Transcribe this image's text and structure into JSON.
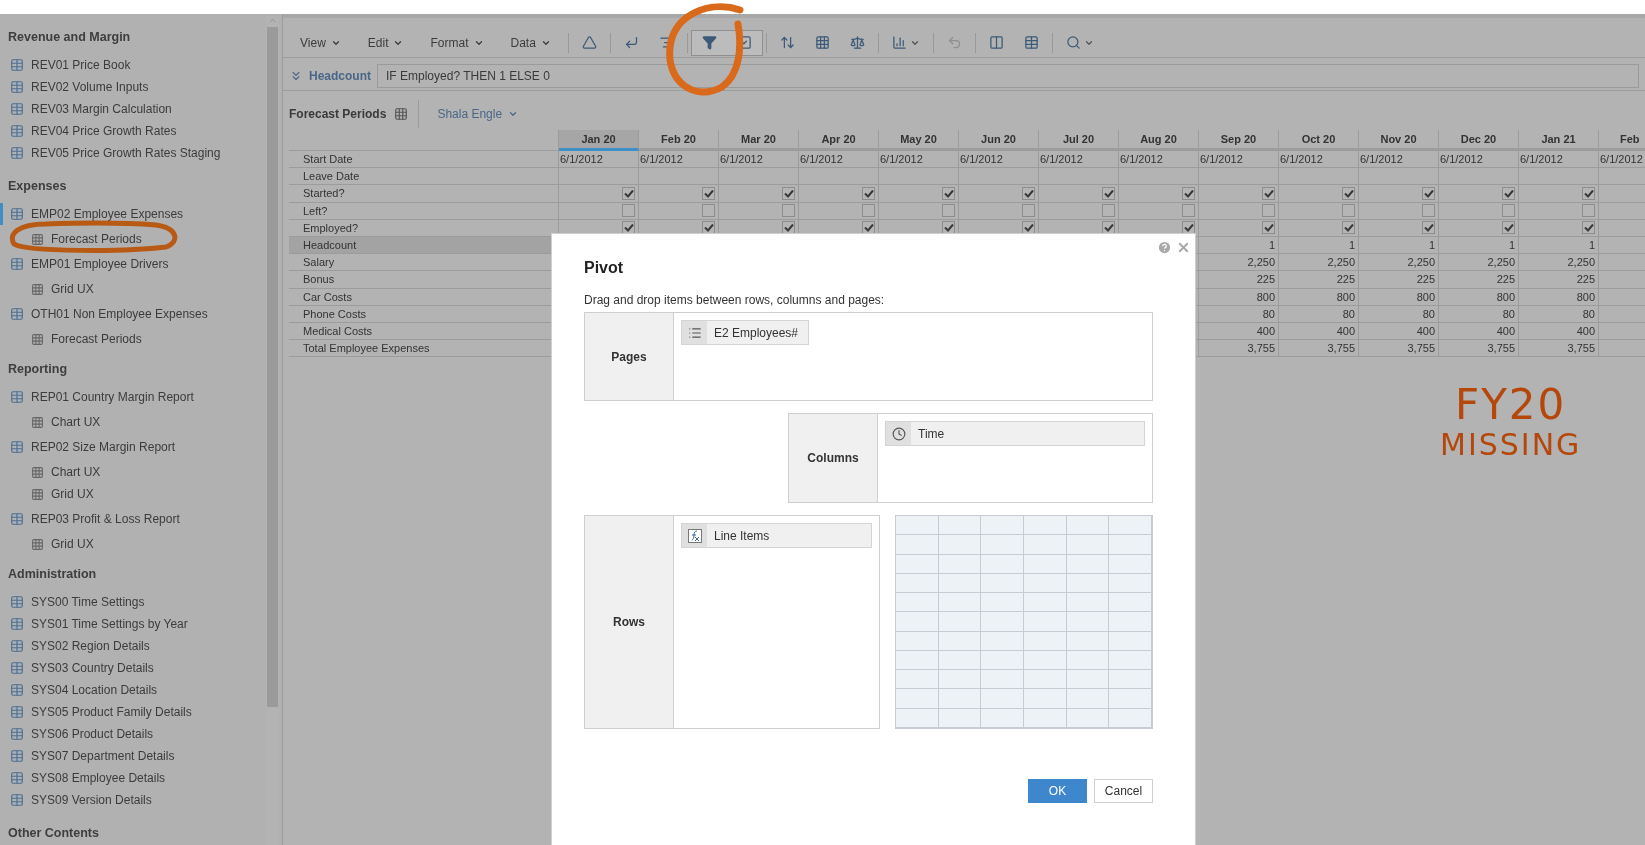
{
  "sidebar": {
    "sections": [
      {
        "title": "Revenue and Margin",
        "items": [
          {
            "label": "REV01 Price Book",
            "selected": false
          },
          {
            "label": "REV02 Volume Inputs",
            "selected": false
          },
          {
            "label": "REV03 Margin Calculation",
            "selected": false
          },
          {
            "label": "REV04 Price Growth Rates",
            "selected": false
          },
          {
            "label": "REV05 Price Growth Rates Staging",
            "selected": false
          }
        ]
      },
      {
        "title": "Expenses",
        "items": [
          {
            "label": "EMP02 Employee Expenses",
            "selected": true,
            "children": [
              {
                "label": "Forecast Periods",
                "selected": false
              }
            ]
          },
          {
            "label": "EMP01 Employee Drivers",
            "selected": false,
            "children": [
              {
                "label": "Grid UX",
                "selected": false
              }
            ]
          },
          {
            "label": "OTH01 Non Employee Expenses",
            "selected": false,
            "children": [
              {
                "label": "Forecast Periods",
                "selected": false
              }
            ]
          }
        ]
      },
      {
        "title": "Reporting",
        "items": [
          {
            "label": "REP01 Country Margin Report",
            "selected": false,
            "children": [
              {
                "label": "Chart UX",
                "selected": false
              }
            ]
          },
          {
            "label": "REP02 Size Margin Report",
            "selected": false,
            "children": [
              {
                "label": "Chart UX",
                "selected": false
              },
              {
                "label": "Grid UX",
                "selected": false
              }
            ]
          },
          {
            "label": "REP03 Profit & Loss Report",
            "selected": false,
            "children": [
              {
                "label": "Grid UX",
                "selected": false
              }
            ]
          }
        ]
      },
      {
        "title": "Administration",
        "items": [
          {
            "label": "SYS00 Time Settings",
            "selected": false
          },
          {
            "label": "SYS01 Time Settings by Year",
            "selected": false
          },
          {
            "label": "SYS02 Region Details",
            "selected": false
          },
          {
            "label": "SYS03 Country Details",
            "selected": false
          },
          {
            "label": "SYS04 Location Details",
            "selected": false
          },
          {
            "label": "SYS05 Product Family Details",
            "selected": false
          },
          {
            "label": "SYS06 Product Details",
            "selected": false
          },
          {
            "label": "SYS07 Department Details",
            "selected": false
          },
          {
            "label": "SYS08 Employee Details",
            "selected": false
          },
          {
            "label": "SYS09 Version Details",
            "selected": false
          }
        ]
      },
      {
        "title": "Other Contents"
      }
    ]
  },
  "toolbar": {
    "menus": [
      "View",
      "Edit",
      "Format",
      "Data"
    ],
    "groups": [
      {
        "active": false,
        "tools": [
          {
            "kind": "ruler",
            "dropdown": false,
            "disabled": false
          }
        ]
      },
      {
        "active": false,
        "tools": [
          {
            "kind": "corner",
            "dropdown": false,
            "disabled": false
          },
          {
            "kind": "align",
            "dropdown": false,
            "disabled": false
          }
        ]
      },
      {
        "active": true,
        "tools": [
          {
            "kind": "filter",
            "dropdown": false,
            "disabled": false
          },
          {
            "kind": "check",
            "dropdown": false,
            "disabled": false
          }
        ]
      },
      {
        "active": false,
        "tools": [
          {
            "kind": "sort",
            "dropdown": false,
            "disabled": false
          },
          {
            "kind": "grid",
            "dropdown": false,
            "disabled": false
          },
          {
            "kind": "scale",
            "dropdown": false,
            "disabled": false
          }
        ]
      },
      {
        "active": false,
        "tools": [
          {
            "kind": "chart",
            "dropdown": true,
            "disabled": false
          }
        ]
      },
      {
        "active": false,
        "tools": [
          {
            "kind": "undo",
            "dropdown": false,
            "disabled": true
          }
        ]
      },
      {
        "active": false,
        "tools": [
          {
            "kind": "columns",
            "dropdown": false,
            "disabled": false
          },
          {
            "kind": "table",
            "dropdown": false,
            "disabled": false
          }
        ]
      },
      {
        "active": false,
        "tools": [
          {
            "kind": "search",
            "dropdown": true,
            "disabled": false
          }
        ]
      }
    ]
  },
  "formula_bar": {
    "item": "Headcount",
    "formula": "IF Employed? THEN 1 ELSE 0"
  },
  "view_bar": {
    "title": "Forecast Periods",
    "page_selector": "Shala Engle"
  },
  "grid": {
    "columns": [
      {
        "label": "Jan 20",
        "selected": true
      },
      {
        "label": "Feb 20",
        "selected": false
      },
      {
        "label": "Mar 20",
        "selected": false
      },
      {
        "label": "Apr 20",
        "selected": false
      },
      {
        "label": "May 20",
        "selected": false
      },
      {
        "label": "Jun 20",
        "selected": false
      },
      {
        "label": "Jul 20",
        "selected": false
      },
      {
        "label": "Aug 20",
        "selected": false
      },
      {
        "label": "Sep 20",
        "selected": false
      },
      {
        "label": "Oct 20",
        "selected": false
      },
      {
        "label": "Nov 20",
        "selected": false
      },
      {
        "label": "Dec 20",
        "selected": false
      },
      {
        "label": "Jan 21",
        "selected": false
      },
      {
        "label": "Feb",
        "selected": false
      }
    ],
    "rows": [
      {
        "label": "Start Date",
        "kind": "text",
        "selected": false,
        "cells": [
          "6/1/2012",
          "6/1/2012",
          "6/1/2012",
          "6/1/2012",
          "6/1/2012",
          "6/1/2012",
          "6/1/2012",
          "6/1/2012",
          "6/1/2012",
          "6/1/2012",
          "6/1/2012",
          "6/1/2012",
          "6/1/2012",
          "6/1/2012"
        ]
      },
      {
        "label": "Leave Date",
        "kind": "text",
        "selected": false
      },
      {
        "label": "Started?",
        "kind": "check",
        "selected": false,
        "cells": [
          true,
          true,
          true,
          true,
          true,
          true,
          true,
          true,
          true,
          true,
          true,
          true,
          true
        ]
      },
      {
        "label": "Left?",
        "kind": "check",
        "selected": false,
        "cells": [
          false,
          false,
          false,
          false,
          false,
          false,
          false,
          false,
          false,
          false,
          false,
          false,
          false
        ]
      },
      {
        "label": "Employed?",
        "kind": "check",
        "selected": false,
        "cells": [
          true,
          true,
          true,
          true,
          true,
          true,
          true,
          true,
          true,
          true,
          true,
          true,
          true
        ]
      },
      {
        "label": "Headcount",
        "kind": "number",
        "selected": true,
        "cells": [
          null,
          null,
          null,
          null,
          null,
          null,
          null,
          null,
          "1",
          "1",
          "1",
          "1",
          "1"
        ]
      },
      {
        "label": "Salary",
        "kind": "number",
        "selected": false,
        "cells": [
          null,
          null,
          null,
          null,
          null,
          null,
          null,
          null,
          "2,250",
          "2,250",
          "2,250",
          "2,250",
          "2,250"
        ]
      },
      {
        "label": "Bonus",
        "kind": "number",
        "selected": false,
        "cells": [
          null,
          null,
          null,
          null,
          null,
          null,
          null,
          null,
          "225",
          "225",
          "225",
          "225",
          "225"
        ]
      },
      {
        "label": "Car Costs",
        "kind": "number",
        "selected": false,
        "cells": [
          null,
          null,
          null,
          null,
          null,
          null,
          null,
          null,
          "800",
          "800",
          "800",
          "800",
          "800"
        ]
      },
      {
        "label": "Phone Costs",
        "kind": "number",
        "selected": false,
        "cells": [
          null,
          null,
          null,
          null,
          null,
          null,
          null,
          null,
          "80",
          "80",
          "80",
          "80",
          "80"
        ]
      },
      {
        "label": "Medical Costs",
        "kind": "number",
        "selected": false,
        "cells": [
          null,
          null,
          null,
          null,
          null,
          null,
          null,
          null,
          "400",
          "400",
          "400",
          "400",
          "400"
        ]
      },
      {
        "label": "Total Employee Expenses",
        "kind": "number",
        "selected": false,
        "cells": [
          null,
          null,
          null,
          null,
          null,
          null,
          null,
          null,
          "3,755",
          "3,755",
          "3,755",
          "3,755",
          "3,755"
        ]
      }
    ]
  },
  "handwritten_note": [
    "FY20",
    "MISSING"
  ],
  "dialog": {
    "title": "Pivot",
    "instructions": "Drag and drop items between rows, columns and pages:",
    "pages": {
      "label": "Pages",
      "items": [
        {
          "label": "E2 Employees#",
          "kind": "list"
        }
      ]
    },
    "columns": {
      "label": "Columns",
      "items": [
        {
          "label": "Time",
          "kind": "time"
        }
      ]
    },
    "rows": {
      "label": "Rows",
      "items": [
        {
          "label": "Line Items",
          "kind": "formula"
        }
      ]
    },
    "buttons": [
      {
        "label": "OK",
        "primary": true
      },
      {
        "label": "Cancel",
        "primary": false
      }
    ]
  }
}
